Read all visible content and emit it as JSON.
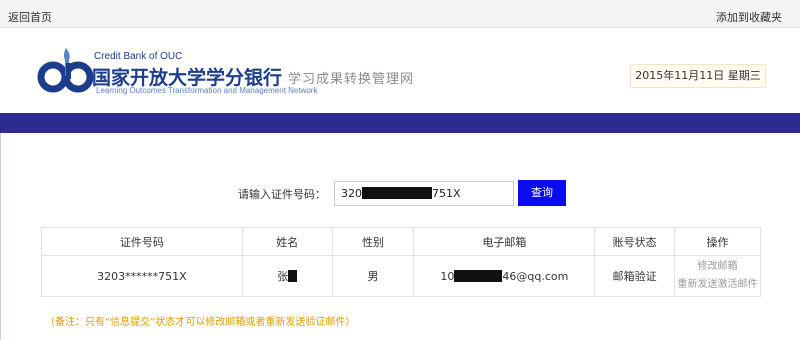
{
  "topbar": {
    "back_label": "返回首页",
    "favorite_label": "添加到收藏夹"
  },
  "header": {
    "brand_en": "Credit Bank of OUC",
    "brand_cn": "国家开放大学学分银行",
    "brand_sub": "学习成果转换管理网",
    "brand_en2": "Learning Outcomes Transformation and Management Network",
    "date": "2015年11月11日 星期三"
  },
  "colors": {
    "brand_blue": "#1c3d8c",
    "bar_blue": "#2d2b8f",
    "button_blue": "#0b0bf0",
    "note_orange": "#e49b00"
  },
  "search": {
    "label": "请输入证件号码：",
    "value_prefix": "320",
    "value_suffix": "751X",
    "button_label": "查询"
  },
  "table": {
    "headers": [
      "证件号码",
      "姓名",
      "性别",
      "电子邮箱",
      "账号状态",
      "操作"
    ],
    "row": {
      "id_number": "3203******751X",
      "name_prefix": "张",
      "gender": "男",
      "email_prefix": "10",
      "email_suffix": "46@qq.com",
      "status": "邮箱验证",
      "action_edit": "修改邮箱",
      "action_resend": "重新发送激活邮件"
    }
  },
  "note": "（备注：只有“信息提交”状态才可以修改邮箱或者重新发送验证邮件）",
  "icons": {
    "logo": "credit-bank-logo-icon"
  }
}
